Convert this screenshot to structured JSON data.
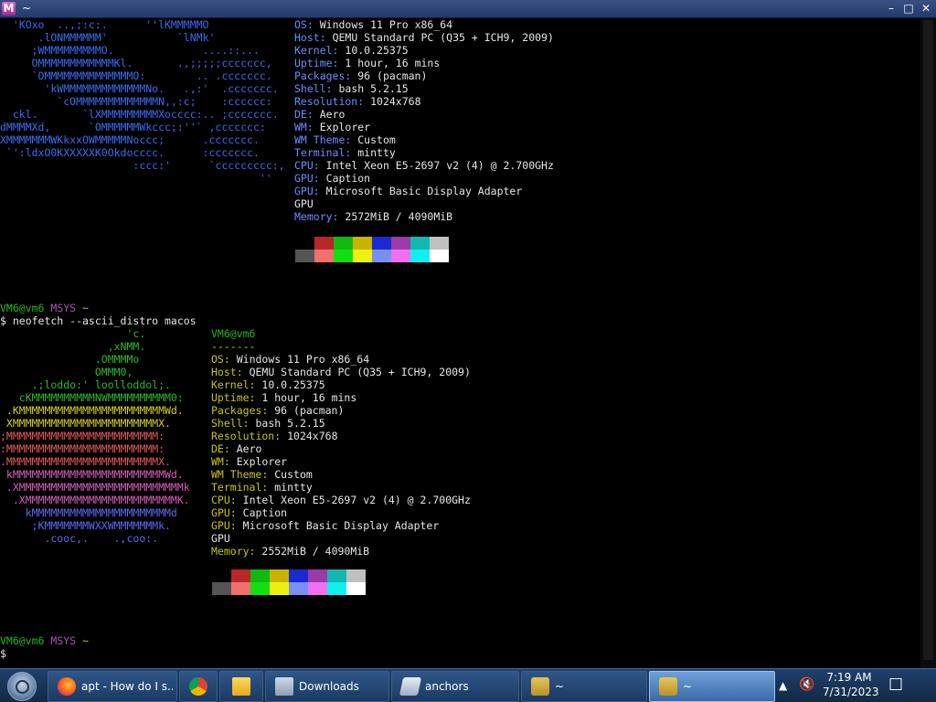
{
  "window": {
    "title": "~",
    "icon_letter": "M",
    "minimize": "–",
    "maximize": "□",
    "close": "✕"
  },
  "top": {
    "ascii": [
      "  'KOxo  ..,;:c:.      ''lKMMMMMO",
      "      .lONMMMMMM'           `lNMk'",
      "     ;WMMMMMMMMMO.              ....::...",
      "     OMMMMMMMMMMMMKl.       .,;;;;;ccccccc,",
      "     `OMMMMMMMMMMMMMMO:        .. .ccccccc.",
      "       'kWMMMMMMMMMMMMMNo.   .,:'  .ccccccc.",
      "         `cOMMMMMMMMMMMMMN,,:c;    :cccccc:",
      "  ckl.       `lXMMMMMMMMMXocccc:.. ;ccccccc.",
      "dMMMMXd,      `OMMMMMMWkccc;:''` ,ccccccc:",
      "XMMMMMMMWKkxxOWMMMMMNoccc;      .ccccccc.",
      " `':ldxO0KXXXXXK0Okdocccc.      :ccccccc.",
      "                     :ccc:'      `ccccccccc:,",
      "                                         ''"
    ],
    "info": [
      {
        "k": "OS",
        "v": "Windows 11 Pro x86_64"
      },
      {
        "k": "Host",
        "v": "QEMU Standard PC (Q35 + ICH9, 2009)"
      },
      {
        "k": "Kernel",
        "v": "10.0.25375"
      },
      {
        "k": "Uptime",
        "v": "1 hour, 16 mins"
      },
      {
        "k": "Packages",
        "v": "96 (pacman)"
      },
      {
        "k": "Shell",
        "v": "bash 5.2.15"
      },
      {
        "k": "Resolution",
        "v": "1024x768"
      },
      {
        "k": "DE",
        "v": "Aero"
      },
      {
        "k": "WM",
        "v": "Explorer"
      },
      {
        "k": "WM Theme",
        "v": "Custom"
      },
      {
        "k": "Terminal",
        "v": "mintty"
      },
      {
        "k": "CPU",
        "v": "Intel Xeon E5-2697 v2 (4) @ 2.700GHz"
      },
      {
        "k": "GPU",
        "v": "Caption"
      },
      {
        "k": "GPU",
        "v": "Microsoft Basic Display Adapter"
      },
      {
        "k": "",
        "v": "GPU"
      },
      {
        "k": "Memory",
        "v": "2572MiB / 4090MiB"
      }
    ]
  },
  "prompt1": {
    "user": "VM6@vm6",
    "host": "MSYS",
    "dir": "~",
    "cmd": "$ neofetch --ascii_distro macos"
  },
  "bottom": {
    "ascii": [
      {
        "c": "#2fb82f",
        "t": "                    'c."
      },
      {
        "c": "#2fb82f",
        "t": "                 ,xNMM."
      },
      {
        "c": "#2fb82f",
        "t": "               .OMMMMo"
      },
      {
        "c": "#2fb82f",
        "t": "               OMMM0,"
      },
      {
        "c": "#2fb82f",
        "t": "     .;loddo:' loolloddol;."
      },
      {
        "c": "#2fb82f",
        "t": "   cKMMMMMMMMMMNWMMMMMMMMMM0:"
      },
      {
        "c": "#d4cf1f",
        "t": " .KMMMMMMMMMMMMMMMMMMMMMMMWd."
      },
      {
        "c": "#d4cf1f",
        "t": " XMMMMMMMMMMMMMMMMMMMMMMMX."
      },
      {
        "c": "#e45a5a",
        "t": ";MMMMMMMMMMMMMMMMMMMMMMMM:"
      },
      {
        "c": "#e45a5a",
        "t": ":MMMMMMMMMMMMMMMMMMMMMMMM:"
      },
      {
        "c": "#e45a5a",
        "t": ".MMMMMMMMMMMMMMMMMMMMMMMMX."
      },
      {
        "c": "#d45fb6",
        "t": " kMMMMMMMMMMMMMMMMMMMMMMMMWd."
      },
      {
        "c": "#d45fb6",
        "t": " .XMMMMMMMMMMMMMMMMMMMMMMMMMMk"
      },
      {
        "c": "#d45fb6",
        "t": "  .XMMMMMMMMMMMMMMMMMMMMMMMMK."
      },
      {
        "c": "#5b6bf0",
        "t": "    kMMMMMMMMMMMMMMMMMMMMMMd"
      },
      {
        "c": "#5b6bf0",
        "t": "     ;KMMMMMMMWXXWMMMMMMMk."
      },
      {
        "c": "#5b6bf0",
        "t": "       .cooc,.    .,coo:."
      }
    ],
    "header": "VM6@vm6",
    "sep": "-------",
    "info": [
      {
        "k": "OS",
        "v": "Windows 11 Pro x86_64"
      },
      {
        "k": "Host",
        "v": "QEMU Standard PC (Q35 + ICH9, 2009)"
      },
      {
        "k": "Kernel",
        "v": "10.0.25375"
      },
      {
        "k": "Uptime",
        "v": "1 hour, 16 mins"
      },
      {
        "k": "Packages",
        "v": "96 (pacman)"
      },
      {
        "k": "Shell",
        "v": "bash 5.2.15"
      },
      {
        "k": "Resolution",
        "v": "1024x768"
      },
      {
        "k": "DE",
        "v": "Aero"
      },
      {
        "k": "WM",
        "v": "Explorer"
      },
      {
        "k": "WM Theme",
        "v": "Custom"
      },
      {
        "k": "Terminal",
        "v": "mintty"
      },
      {
        "k": "CPU",
        "v": "Intel Xeon E5-2697 v2 (4) @ 2.700GHz"
      },
      {
        "k": "GPU",
        "v": "Caption"
      },
      {
        "k": "GPU",
        "v": "Microsoft Basic Display Adapter"
      },
      {
        "k": "",
        "v": "GPU"
      },
      {
        "k": "Memory",
        "v": "2552MiB / 4090MiB"
      }
    ]
  },
  "prompt2": {
    "user": "VM6@vm6",
    "host": "MSYS",
    "dir": "~",
    "cmd": "$"
  },
  "palette_top": [
    "#000000",
    "#b82828",
    "#12b812",
    "#c8b400",
    "#1a2ad0",
    "#9b3aa8",
    "#12b8b0",
    "#c0c0c0"
  ],
  "palette_bottom": [
    "#555555",
    "#f07070",
    "#10e010",
    "#f0f010",
    "#7a90f0",
    "#f070f0",
    "#10f0f0",
    "#ffffff"
  ],
  "taskbar": {
    "tasks": [
      {
        "label": "apt - How do I s...",
        "icon": "firefox-icon"
      },
      {
        "label": "",
        "icon": "chrome-icon"
      },
      {
        "label": "",
        "icon": "folder-icon"
      },
      {
        "label": "Downloads",
        "icon": "downloads-icon"
      },
      {
        "label": "anchors",
        "icon": "anchors-icon"
      },
      {
        "label": "~",
        "icon": "mintty-icon"
      },
      {
        "label": "~",
        "icon": "mintty-icon"
      }
    ],
    "time": "7:19 AM",
    "date": "7/31/2023",
    "tray_arrow": "▲",
    "volume": "🔇",
    "notification": "☐"
  }
}
